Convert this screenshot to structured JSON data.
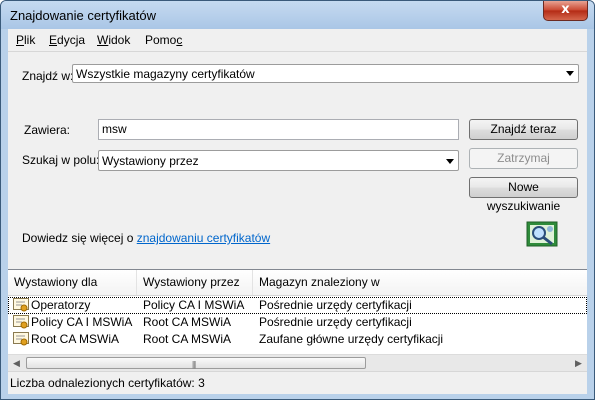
{
  "window": {
    "title": "Znajdowanie certyfikatów",
    "close_label": "x"
  },
  "menu": [
    {
      "key": "P",
      "rest": "lik"
    },
    {
      "key": "E",
      "rest": "dycja"
    },
    {
      "key": "W",
      "rest": "idok"
    },
    {
      "key_pre": "Pomo",
      "key": "c"
    }
  ],
  "find_in": {
    "label": "Znajdź w:",
    "value": "Wszystkie magazyny certyfikatów"
  },
  "contains": {
    "label": "Zawiera:",
    "value": "msw"
  },
  "search_field": {
    "label": "Szukaj w polu:",
    "value": "Wystawiony przez"
  },
  "buttons": {
    "find_now": "Znajdź teraz",
    "stop": "Zatrzymaj",
    "new_search": "Nowe wyszukiwanie"
  },
  "info": {
    "prefix": "Dowiedz się więcej o ",
    "link": "znajdowaniu certyfikatów"
  },
  "table": {
    "columns": [
      "Wystawiony dla",
      "Wystawiony przez",
      "Magazyn znaleziony w"
    ],
    "rows": [
      [
        "Operatorzy",
        "Policy CA I MSWiA",
        "Pośrednie urzędy certyfikacji"
      ],
      [
        "Policy CA I MSWiA",
        "Root CA MSWiA",
        "Pośrednie urzędy certyfikacji"
      ],
      [
        "Root CA MSWiA",
        "Root CA MSWiA",
        "Zaufane główne urzędy certyfikacji"
      ]
    ]
  },
  "scrollbar": {
    "left_arrow": "◀",
    "right_arrow": "▶",
    "grip": "|||"
  },
  "status": "Liczba odnalezionych certyfikatów: 3",
  "icons": {
    "row_icon": "certificate-icon",
    "search_art": "search-certificate-icon"
  }
}
